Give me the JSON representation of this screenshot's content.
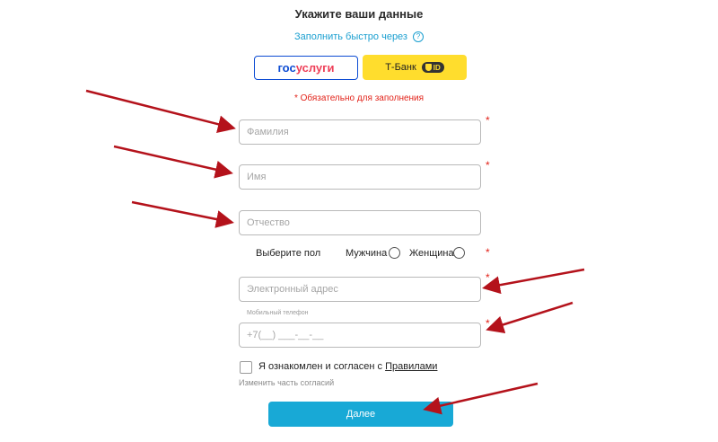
{
  "form": {
    "title": "Укажите ваши данные",
    "quick_fill_label": "Заполнить быстро через",
    "help_icon": "?",
    "required_note": "* Обязательно для заполнения",
    "required_star": "*"
  },
  "providers": {
    "gosuslugi": {
      "part1": "гос",
      "part2": "услуги"
    },
    "tbank": {
      "label": "Т-Банк",
      "badge": "ID"
    }
  },
  "fields": {
    "surname_placeholder": "Фамилия",
    "name_placeholder": "Имя",
    "patronymic_placeholder": "Отчество",
    "email_placeholder": "Электронный адрес",
    "phone_label": "Мобильный телефон",
    "phone_placeholder": "+7(__) ___-__-__"
  },
  "gender": {
    "label": "Выберите пол",
    "male": "Мужчина",
    "female": "Женщина"
  },
  "consent": {
    "text": "Я ознакомлен и согласен с ",
    "link": "Правилами",
    "change_label": "Изменить часть согласий"
  },
  "submit_label": "Далее",
  "colors": {
    "accent": "#18a9d6",
    "required": "#e2231a",
    "arrow": "#b4121b",
    "tbank_yellow": "#ffdd2d",
    "gos_blue": "#0d4cd3",
    "gos_red": "#ee3f58"
  }
}
